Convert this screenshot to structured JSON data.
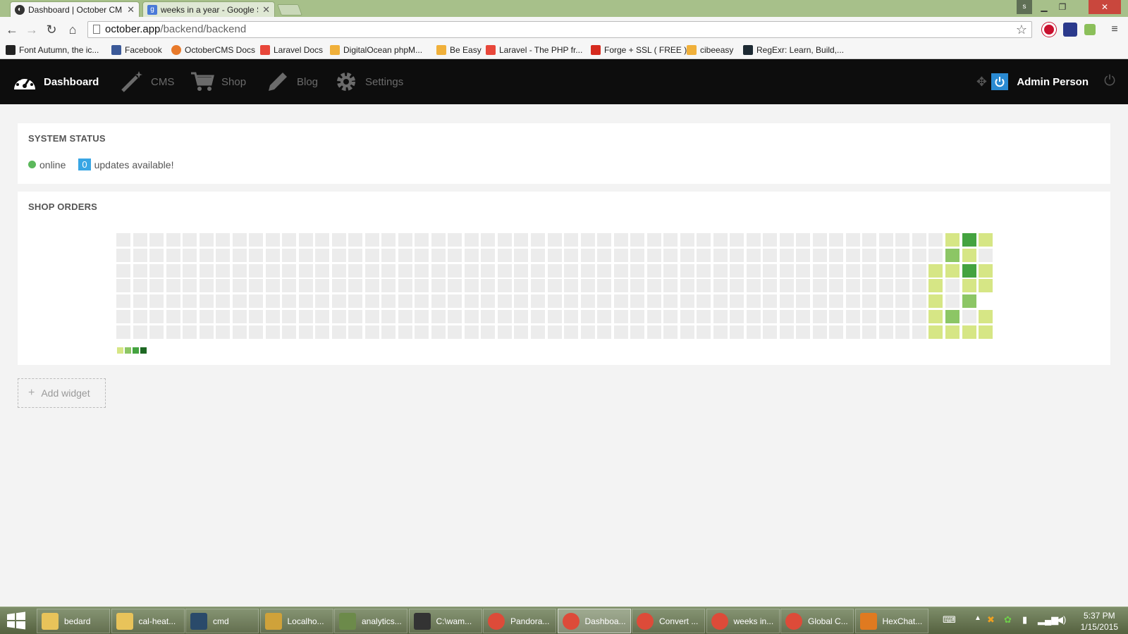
{
  "browser": {
    "tabs": [
      {
        "title": "Dashboard | October CMS",
        "active": true
      },
      {
        "title": "weeks in a year - Google S",
        "active": false
      }
    ],
    "address": {
      "host": "october.app",
      "path": "/backend/backend"
    },
    "user_badge": "s",
    "bookmarks": [
      "Font Autumn, the ic...",
      "Facebook",
      "OctoberCMS Docs",
      "Laravel Docs",
      "DigitalOcean phpM...",
      "Be Easy",
      "Laravel - The PHP fr...",
      "Forge + SSL ( FREE )",
      "cibeeasy",
      "RegExr: Learn, Build,..."
    ]
  },
  "nav": {
    "items": [
      {
        "label": "Dashboard",
        "icon": "dashboard-icon",
        "active": true
      },
      {
        "label": "CMS",
        "icon": "magic-wand-icon",
        "active": false
      },
      {
        "label": "Shop",
        "icon": "cart-icon",
        "active": false
      },
      {
        "label": "Blog",
        "icon": "pencil-icon",
        "active": false
      },
      {
        "label": "Settings",
        "icon": "gear-icon",
        "active": false
      }
    ],
    "user_name": "Admin Person"
  },
  "system_status": {
    "title": "SYSTEM STATUS",
    "status_text": "online",
    "updates_count": "0",
    "updates_text": "updates available!"
  },
  "shop_orders": {
    "title": "SHOP ORDERS",
    "heatmap": {
      "weeks": 53,
      "days_per_week": 7,
      "scale_colors": [
        "#ececec",
        "#d6e685",
        "#8cc665",
        "#44a340",
        "#1e6823"
      ],
      "active_cells": [
        {
          "week": 49,
          "day": 2,
          "level": 1
        },
        {
          "week": 49,
          "day": 3,
          "level": 1
        },
        {
          "week": 49,
          "day": 4,
          "level": 1
        },
        {
          "week": 49,
          "day": 5,
          "level": 1
        },
        {
          "week": 49,
          "day": 6,
          "level": 1
        },
        {
          "week": 50,
          "day": 0,
          "level": 1
        },
        {
          "week": 50,
          "day": 1,
          "level": 2
        },
        {
          "week": 50,
          "day": 2,
          "level": 1
        },
        {
          "week": 50,
          "day": 5,
          "level": 2
        },
        {
          "week": 50,
          "day": 6,
          "level": 1
        },
        {
          "week": 51,
          "day": 0,
          "level": 3
        },
        {
          "week": 51,
          "day": 1,
          "level": 1
        },
        {
          "week": 51,
          "day": 2,
          "level": 3
        },
        {
          "week": 51,
          "day": 3,
          "level": 1
        },
        {
          "week": 51,
          "day": 4,
          "level": 2
        },
        {
          "week": 51,
          "day": 6,
          "level": 1
        },
        {
          "week": 52,
          "day": 0,
          "level": 1
        },
        {
          "week": 52,
          "day": 2,
          "level": 1
        },
        {
          "week": 52,
          "day": 3,
          "level": 1
        },
        {
          "week": 52,
          "day": 5,
          "level": 1
        },
        {
          "week": 52,
          "day": 6,
          "level": 1
        },
        {
          "week": 53,
          "day": 1,
          "level": 3
        }
      ]
    }
  },
  "add_widget_label": "Add widget",
  "taskbar": {
    "items": [
      {
        "label": "bedard",
        "active": false
      },
      {
        "label": "cal-heat...",
        "active": false
      },
      {
        "label": "cmd",
        "active": false
      },
      {
        "label": "Localho...",
        "active": false
      },
      {
        "label": "analytics...",
        "active": false
      },
      {
        "label": "C:\\wam...",
        "active": false
      },
      {
        "label": "Pandora...",
        "active": false
      },
      {
        "label": "Dashboa...",
        "active": true
      },
      {
        "label": "Convert ...",
        "active": false
      },
      {
        "label": "weeks in...",
        "active": false
      },
      {
        "label": "Global C...",
        "active": false
      },
      {
        "label": "HexChat...",
        "active": false
      }
    ],
    "time": "5:37 PM",
    "date": "1/15/2015"
  }
}
